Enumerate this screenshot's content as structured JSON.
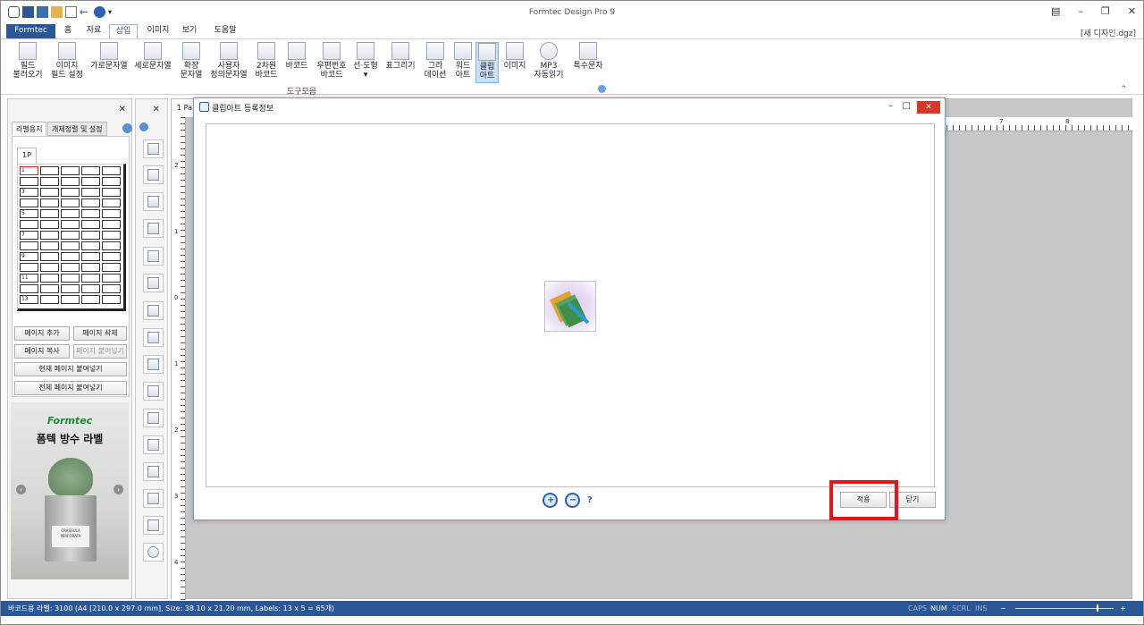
{
  "app": {
    "title": "Formtec Design Pro 9",
    "document": "[새 디자인.dgz]"
  },
  "menu": {
    "tabs": [
      "Formtec",
      "홈",
      "자료",
      "삽입",
      "이미지",
      "보기",
      "도움말"
    ],
    "active": "삽입"
  },
  "ribbon": {
    "items": [
      {
        "label": "필드\n불러오기",
        "icon": "field-load-icon"
      },
      {
        "label": "이미지\n필드 설정",
        "icon": "image-field-icon"
      },
      {
        "label": "가로문자열",
        "icon": "horizontal-text-icon"
      },
      {
        "label": "세로문자열",
        "icon": "vertical-text-icon"
      },
      {
        "label": "확장\n문자열",
        "icon": "extended-text-icon"
      },
      {
        "label": "사용자\n정의문자열",
        "icon": "custom-text-icon"
      },
      {
        "label": "2차원\n바코드",
        "icon": "qr-code-icon"
      },
      {
        "label": "바코드",
        "icon": "barcode-icon"
      },
      {
        "label": "우편번호\n바코드",
        "icon": "postal-barcode-icon"
      },
      {
        "label": "선·도형\n▾",
        "icon": "shape-icon"
      },
      {
        "label": "표그리기",
        "icon": "table-icon"
      },
      {
        "label": "그라\n데이션",
        "icon": "gradient-icon"
      },
      {
        "label": "워드\n아트",
        "icon": "wordart-icon"
      },
      {
        "label": "클립\n아트",
        "icon": "clipart-icon"
      },
      {
        "label": "이미지",
        "icon": "image-icon"
      },
      {
        "label": "MP3\n자동읽기",
        "icon": "mp3-icon"
      },
      {
        "label": "특수문자",
        "icon": "special-char-icon"
      }
    ],
    "group_label": "도구모음",
    "selected": "클립\n아트"
  },
  "left_panel": {
    "tabs": [
      "라벨용지",
      "개체정렬 및 설정"
    ],
    "page_tab": "1P",
    "label_numbers": [
      "1",
      "3",
      "5",
      "7",
      "9",
      "11",
      "13"
    ],
    "buttons": {
      "add_page": "페이지 추가",
      "delete_page": "페이지 삭제",
      "copy_page": "페이지 복사",
      "paste_page": "페이지 붙여넣기",
      "paste_current": "현재 페이지 붙여넣기",
      "paste_all": "전체 페이지 붙여넣기"
    },
    "ad": {
      "brand": "Formtec",
      "headline": "폼텍 방수 라벨",
      "pot_label": "CRASSULA PERFORATA"
    }
  },
  "document": {
    "tab": "1 Pa",
    "vruler_labels": [
      "2",
      "1",
      "0",
      "1",
      "2",
      "3",
      "4"
    ],
    "hruler_labels": [
      "7",
      "8"
    ]
  },
  "dialog": {
    "title": "클립아트 등록정보",
    "apply": "적용",
    "close": "닫기",
    "help": "?"
  },
  "status": {
    "text": "바코드용 라벨: 3100 (A4 [210.0 x 297.0 mm], Size: 38.10 x 21.20 mm,  Labels: 13 x 5 = 65개)",
    "caps": "CAPS",
    "num": "NUM",
    "scrl": "SCRL",
    "ins": "INS",
    "zoom_minus": "−",
    "zoom_plus": "+"
  },
  "colors": {
    "accent": "#2b5797",
    "highlight": "#e8141a",
    "close_red": "#d9372b"
  }
}
